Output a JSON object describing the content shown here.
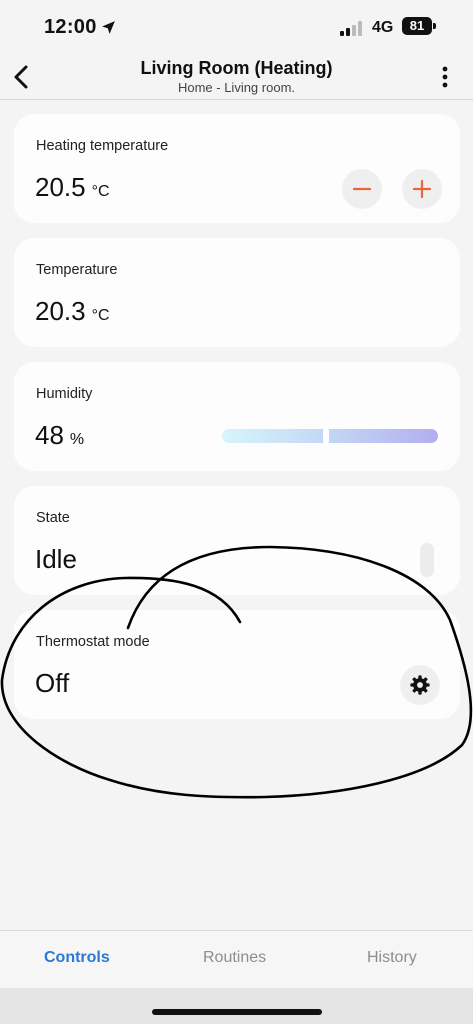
{
  "status_bar": {
    "time": "12:00",
    "network": "4G",
    "battery": "81"
  },
  "header": {
    "title": "Living Room (Heating)",
    "subtitle": "Home - Living room."
  },
  "cards": {
    "heating_temperature": {
      "label": "Heating temperature",
      "value": "20.5",
      "unit": "°C"
    },
    "temperature": {
      "label": "Temperature",
      "value": "20.3",
      "unit": "°C"
    },
    "humidity": {
      "label": "Humidity",
      "value": "48",
      "unit": "%",
      "level": 0.48
    },
    "state": {
      "label": "State",
      "value": "Idle"
    },
    "thermostat_mode": {
      "label": "Thermostat mode",
      "value": "Off"
    }
  },
  "tabs": [
    {
      "label": "Controls",
      "active": true
    },
    {
      "label": "Routines",
      "active": false
    },
    {
      "label": "History",
      "active": false
    }
  ],
  "icons": {
    "location": "location-arrow-icon",
    "back": "chevron-left-icon",
    "more": "more-vertical-icon",
    "minus": "minus-icon",
    "plus": "plus-icon",
    "settings": "gear-icon"
  },
  "colors": {
    "accent_blue": "#2b78d8",
    "stepper_orange": "#e8663a",
    "annotation_ink": "#000000"
  }
}
